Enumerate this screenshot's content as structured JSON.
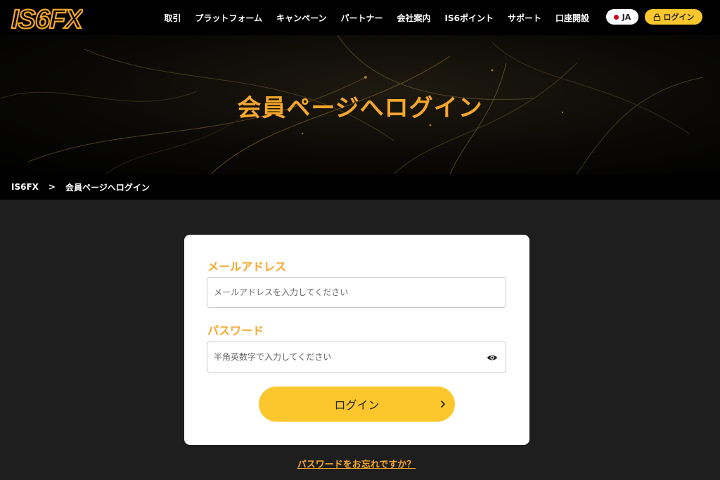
{
  "header": {
    "logo_text": "IS6FX",
    "nav": [
      "取引",
      "プラットフォーム",
      "キャンペーン",
      "パートナー",
      "会社案内",
      "IS6ポイント",
      "サポート",
      "口座開設"
    ],
    "language": "JA",
    "login_label": "ログイン"
  },
  "hero": {
    "title": "会員ページへログイン"
  },
  "breadcrumb": {
    "home": "IS6FX",
    "separator": ">",
    "current": "会員ページへログイン"
  },
  "form": {
    "email_label": "メールアドレス",
    "email_placeholder": "メールアドレスを入力してください",
    "password_label": "パスワード",
    "password_placeholder": "半角英数字で入力してください",
    "submit_label": "ログイン",
    "forgot_label": "パスワードをお忘れですか？"
  },
  "colors": {
    "accent": "#f6a72b",
    "button": "#fcc72c",
    "background": "#1e1e1e",
    "header": "#000000"
  },
  "icons": [
    "lock-icon",
    "eye-icon",
    "chevron-right-icon",
    "flag-jp-icon"
  ]
}
